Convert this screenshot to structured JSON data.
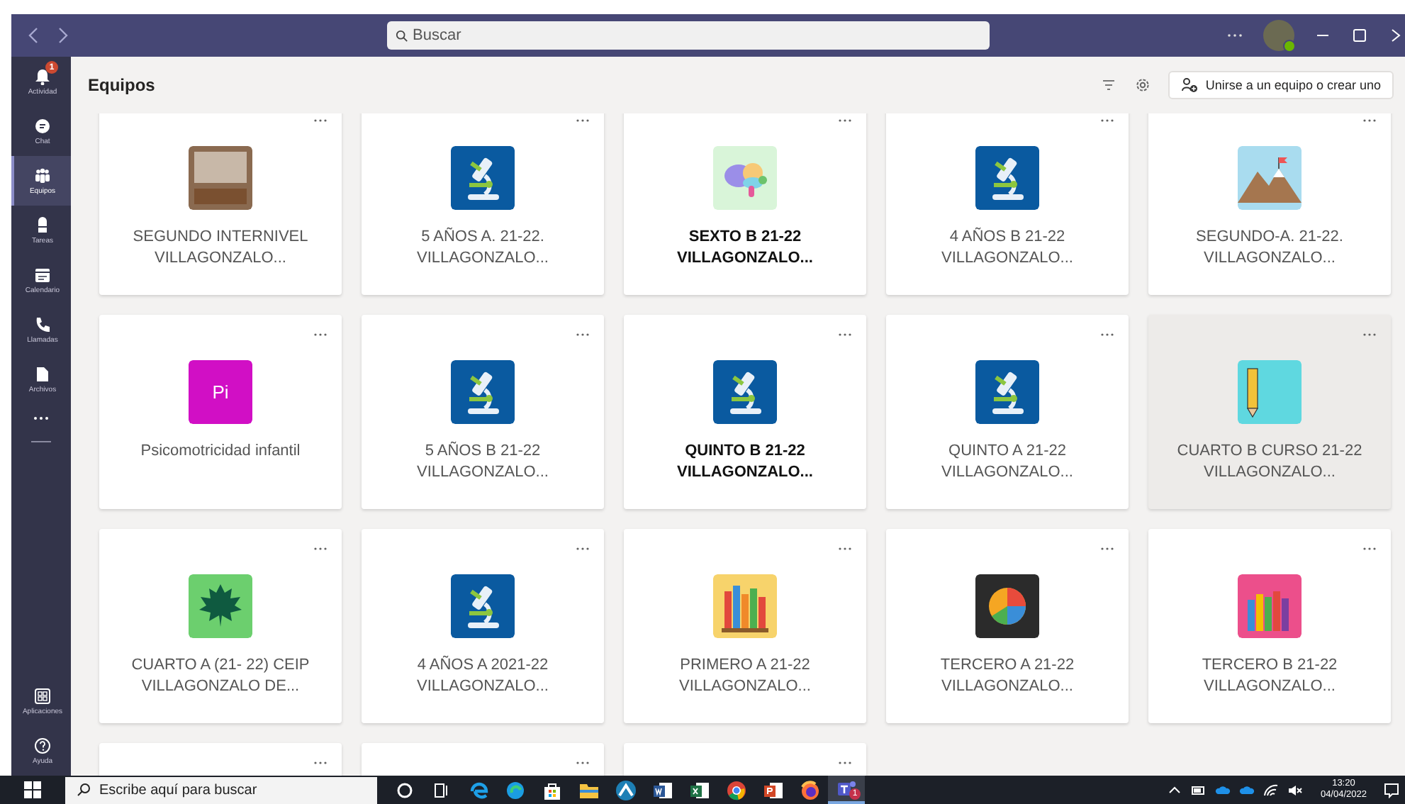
{
  "title_bar": {
    "search": {
      "placeholder": "Buscar"
    }
  },
  "app_bar": {
    "items": [
      {
        "kind": "bell",
        "label": "Actividad",
        "selected": false,
        "badge": "1"
      },
      {
        "kind": "chat",
        "label": "Chat",
        "selected": false
      },
      {
        "kind": "teams",
        "label": "Equipos",
        "selected": true
      },
      {
        "kind": "backpack",
        "label": "Tareas",
        "selected": false
      },
      {
        "kind": "calendar",
        "label": "Calendario",
        "selected": false
      },
      {
        "kind": "phone",
        "label": "Llamadas",
        "selected": false
      },
      {
        "kind": "file",
        "label": "Archivos",
        "selected": false
      }
    ],
    "bottom_items": [
      {
        "kind": "apps",
        "label": "Aplicaciones",
        "selected": false
      },
      {
        "kind": "help",
        "label": "Ayuda",
        "selected": false
      }
    ]
  },
  "header": {
    "title": "Equipos",
    "join_button": "Unirse a un equipo o crear uno"
  },
  "teams": [
    {
      "name": "SEGUNDO INTERNIVEL VILLAGONZALO...",
      "kind": "photo",
      "unread": false,
      "hovered": false
    },
    {
      "name": "5 AÑOS A. 21-22. VILLAGONZALO...",
      "kind": "microscope",
      "unread": false,
      "hovered": false
    },
    {
      "name": "SEXTO B 21-22 VILLAGONZALO...",
      "kind": "brain",
      "unread": true,
      "hovered": false
    },
    {
      "name": "4 AÑOS B 21-22 VILLAGONZALO...",
      "kind": "microscope",
      "unread": false,
      "hovered": false
    },
    {
      "name": "SEGUNDO-A. 21-22. VILLAGONZALO...",
      "kind": "mountain",
      "unread": false,
      "hovered": false
    },
    {
      "name": "Psicomotricidad infantil",
      "kind": "initials",
      "initials": "Pi",
      "unread": false,
      "hovered": false
    },
    {
      "name": "5 AÑOS B 21-22 VILLAGONZALO...",
      "kind": "microscope",
      "unread": false,
      "hovered": false
    },
    {
      "name": "QUINTO B 21-22 VILLAGONZALO...",
      "kind": "microscope",
      "unread": true,
      "hovered": false
    },
    {
      "name": "QUINTO A 21-22 VILLAGONZALO...",
      "kind": "microscope",
      "unread": false,
      "hovered": false
    },
    {
      "name": "CUARTO B CURSO 21-22 VILLAGONZALO...",
      "kind": "pencil",
      "unread": false,
      "hovered": true
    },
    {
      "name": "CUARTO A (21- 22) CEIP VILLAGONZALO DE...",
      "kind": "leaf",
      "unread": false,
      "hovered": false
    },
    {
      "name": "4 AÑOS A 2021-22 VILLAGONZALO...",
      "kind": "microscope",
      "unread": false,
      "hovered": false
    },
    {
      "name": "PRIMERO A 21-22 VILLAGONZALO...",
      "kind": "books",
      "unread": false,
      "hovered": false
    },
    {
      "name": "TERCERO A 21-22 VILLAGONZALO...",
      "kind": "pie",
      "unread": false,
      "hovered": false
    },
    {
      "name": "TERCERO B 21-22 VILLAGONZALO...",
      "kind": "pencils",
      "unread": false,
      "hovered": false
    },
    {
      "hovered": false
    },
    {
      "hovered": false
    },
    {
      "hovered": false
    }
  ],
  "taskbar": {
    "search": {
      "placeholder": "Escribe aquí para buscar"
    },
    "apps": [
      {
        "kind": "cortana",
        "active": false
      },
      {
        "kind": "taskview",
        "active": false
      },
      {
        "kind": "ie",
        "active": false
      },
      {
        "kind": "edge",
        "active": false
      },
      {
        "kind": "store",
        "active": false
      },
      {
        "kind": "folder",
        "active": false
      },
      {
        "kind": "triangle",
        "active": false
      },
      {
        "kind": "word",
        "active": false
      },
      {
        "kind": "excel",
        "active": false
      },
      {
        "kind": "chrome",
        "active": false
      },
      {
        "kind": "powerpoint",
        "active": false
      },
      {
        "kind": "firefox",
        "active": false
      },
      {
        "kind": "teams",
        "active": true,
        "badge": "1"
      }
    ],
    "time": "13:20",
    "date": "04/04/2022"
  }
}
